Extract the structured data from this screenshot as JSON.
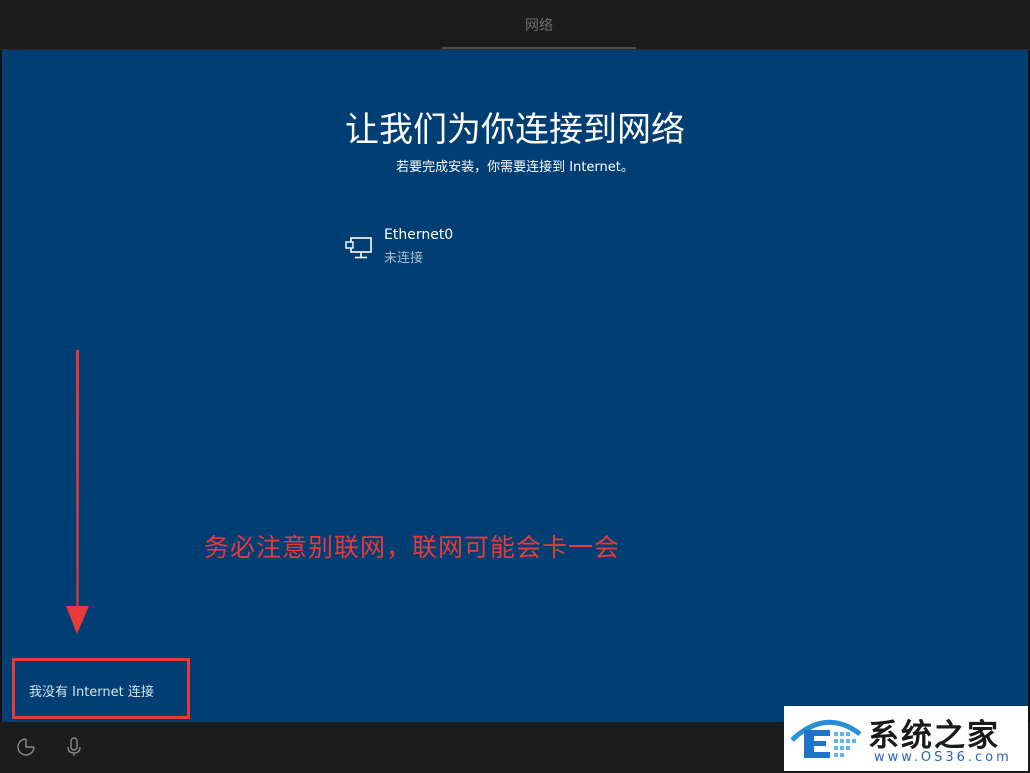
{
  "header": {
    "tab_label": "网络"
  },
  "main": {
    "title": "让我们为你连接到网络",
    "subtitle": "若要完成安装，你需要连接到 Internet。",
    "network": {
      "name": "Ethernet0",
      "status": "未连接",
      "icon": "ethernet-icon"
    }
  },
  "annotation": {
    "text": "务必注意别联网，联网可能会卡一会"
  },
  "footer": {
    "no_internet_label": "我没有 Internet 连接",
    "icons": [
      "accessibility-icon",
      "microphone-icon"
    ]
  },
  "watermark": {
    "name": "系统之家",
    "url": "www.OS36.com"
  },
  "colors": {
    "background": "#003e74",
    "topbar": "#1c1c1c",
    "annotation_red": "#e8393b",
    "text_white": "#ffffff"
  }
}
